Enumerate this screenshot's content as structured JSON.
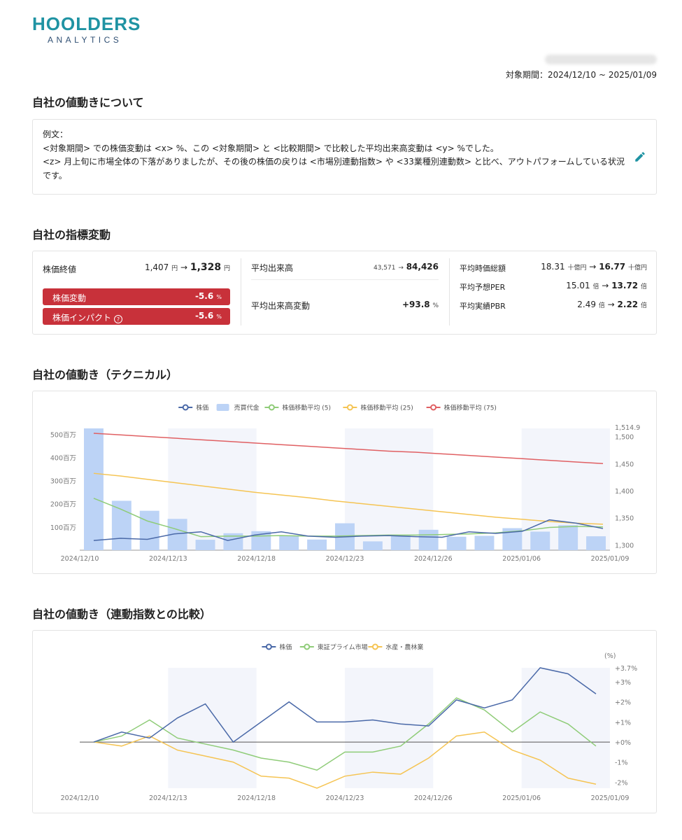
{
  "brand": {
    "main": "HOOLDERS",
    "sub": "ANALYTICS"
  },
  "period_label": "対象期間：2024/12/10 ~ 2025/01/09",
  "section1": {
    "title": "自社の値動きについて",
    "lines": [
      "例文：",
      "<対象期間> での株価変動は <x> %、この <対象期間> と <比較期間> で比較した平均出来高変動は <y> %でした。",
      "<z> 月上旬に市場全体の下落がありましたが、その後の株価の戻りは <市場別連動指数> や <33業種別連動数> と比べ、アウトパフォームしている状況です。"
    ]
  },
  "section2": {
    "title": "自社の指標変動",
    "close": {
      "label": "株価終値",
      "from": "1,407",
      "from_unit": "円",
      "arrow": "→",
      "to": "1,328",
      "to_unit": "円"
    },
    "change": {
      "label": "株価変動",
      "value": "-5.6",
      "unit": "%"
    },
    "impact": {
      "label": "株価インパクト",
      "value": "-5.6",
      "unit": "%",
      "help": "?"
    },
    "volume": {
      "label": "平均出来高",
      "from": "43,571",
      "arrow": "→",
      "to": "84,426"
    },
    "volume_change": {
      "label": "平均出来高変動",
      "value": "+93.8",
      "unit": "%"
    },
    "mcap": {
      "label": "平均時価総額",
      "from": "18.31",
      "from_unit": "十億円",
      "arrow": "→",
      "to": "16.77",
      "to_unit": "十億円"
    },
    "per": {
      "label": "平均予想PER",
      "from": "15.01",
      "from_unit": "倍",
      "arrow": "→",
      "to": "13.72",
      "to_unit": "倍"
    },
    "pbr": {
      "label": "平均実績PBR",
      "from": "2.49",
      "from_unit": "倍",
      "arrow": "→",
      "to": "2.22",
      "to_unit": "倍"
    }
  },
  "section3": {
    "title": "自社の値動き（テクニカル）"
  },
  "section4": {
    "title": "自社の値動き（連動指数との比較）"
  },
  "colors": {
    "blue": "#4a69a8",
    "bar": "#bcd3f6",
    "green": "#8fcc78",
    "yellow": "#f5c453",
    "red": "#e06063",
    "badge": "#c8313a",
    "teal": "#1f93a3"
  },
  "chart_data": [
    {
      "type": "bar",
      "x_tick_labels": [
        "2024/12/10",
        "2024/12/13",
        "2024/12/18",
        "2024/12/23",
        "2024/12/26",
        "2025/01/06",
        "2025/01/09"
      ],
      "y_left_ticks": [
        "100百万",
        "200百万",
        "300百万",
        "400百万",
        "500百万"
      ],
      "y_left_range": [
        0,
        525
      ],
      "y_right_ticks": [
        "1,300",
        "1,350",
        "1,400",
        "1,450",
        "1,500",
        "1,514.9"
      ],
      "y_right_range": [
        1290,
        1515
      ],
      "series": [
        {
          "name": "株価",
          "type": "line",
          "values": [
            1308,
            1312,
            1310,
            1320,
            1324,
            1308,
            1318,
            1324,
            1316,
            1314,
            1316,
            1317,
            1315,
            1314,
            1324,
            1321,
            1325,
            1346,
            1340,
            1330
          ]
        },
        {
          "name": "売買代金",
          "type": "bar",
          "values": [
            525,
            213,
            170,
            135,
            45,
            73,
            82,
            62,
            46,
            116,
            38,
            65,
            88,
            58,
            62,
            95,
            80,
            108,
            60
          ]
        },
        {
          "name": "株価移動平均 (5)",
          "type": "line",
          "values": [
            1386,
            1366,
            1344,
            1330,
            1315,
            1316,
            1316,
            1317,
            1316,
            1316,
            1317,
            1318,
            1318,
            1319,
            1320,
            1322,
            1326,
            1332,
            1334,
            1333
          ]
        },
        {
          "name": "株価移動平均 (25)",
          "type": "line",
          "values": [
            1432,
            1427,
            1421,
            1415,
            1409,
            1403,
            1397,
            1392,
            1387,
            1381,
            1376,
            1371,
            1366,
            1361,
            1356,
            1351,
            1347,
            1343,
            1340,
            1338
          ]
        },
        {
          "name": "株価移動平均 (75)",
          "type": "line",
          "values": [
            1506,
            1503,
            1500,
            1497,
            1494,
            1491,
            1488,
            1485,
            1482,
            1479,
            1476,
            1473,
            1471,
            1468,
            1465,
            1462,
            1459,
            1456,
            1453,
            1450
          ]
        }
      ]
    },
    {
      "type": "line",
      "unit_label": "(%)",
      "x_tick_labels": [
        "2024/12/10",
        "2024/12/13",
        "2024/12/18",
        "2024/12/23",
        "2024/12/26",
        "2025/01/06",
        "2025/01/09"
      ],
      "y_ticks": [
        "-2%",
        "-1%",
        "+0%",
        "+1%",
        "+2%",
        "+3%",
        "+3.7%"
      ],
      "y_range": [
        -2.3,
        3.7
      ],
      "series": [
        {
          "name": "株価",
          "values": [
            0,
            0.5,
            0.2,
            1.2,
            1.9,
            0,
            1.0,
            2.0,
            1.0,
            1.0,
            1.1,
            0.9,
            0.8,
            2.1,
            1.7,
            2.1,
            3.7,
            3.4,
            2.4
          ]
        },
        {
          "name": "東証プライム市場",
          "values": [
            0,
            0.3,
            1.1,
            0.2,
            -0.1,
            -0.4,
            -0.8,
            -1.0,
            -1.4,
            -0.5,
            -0.5,
            -0.2,
            0.9,
            2.2,
            1.6,
            0.5,
            1.5,
            0.9,
            -0.2
          ]
        },
        {
          "name": "水産・農林業",
          "values": [
            0,
            -0.2,
            0.3,
            -0.4,
            -0.7,
            -1.0,
            -1.7,
            -1.8,
            -2.3,
            -1.7,
            -1.5,
            -1.6,
            -0.8,
            0.3,
            0.5,
            -0.4,
            -0.9,
            -1.8,
            -2.1
          ]
        }
      ]
    }
  ]
}
